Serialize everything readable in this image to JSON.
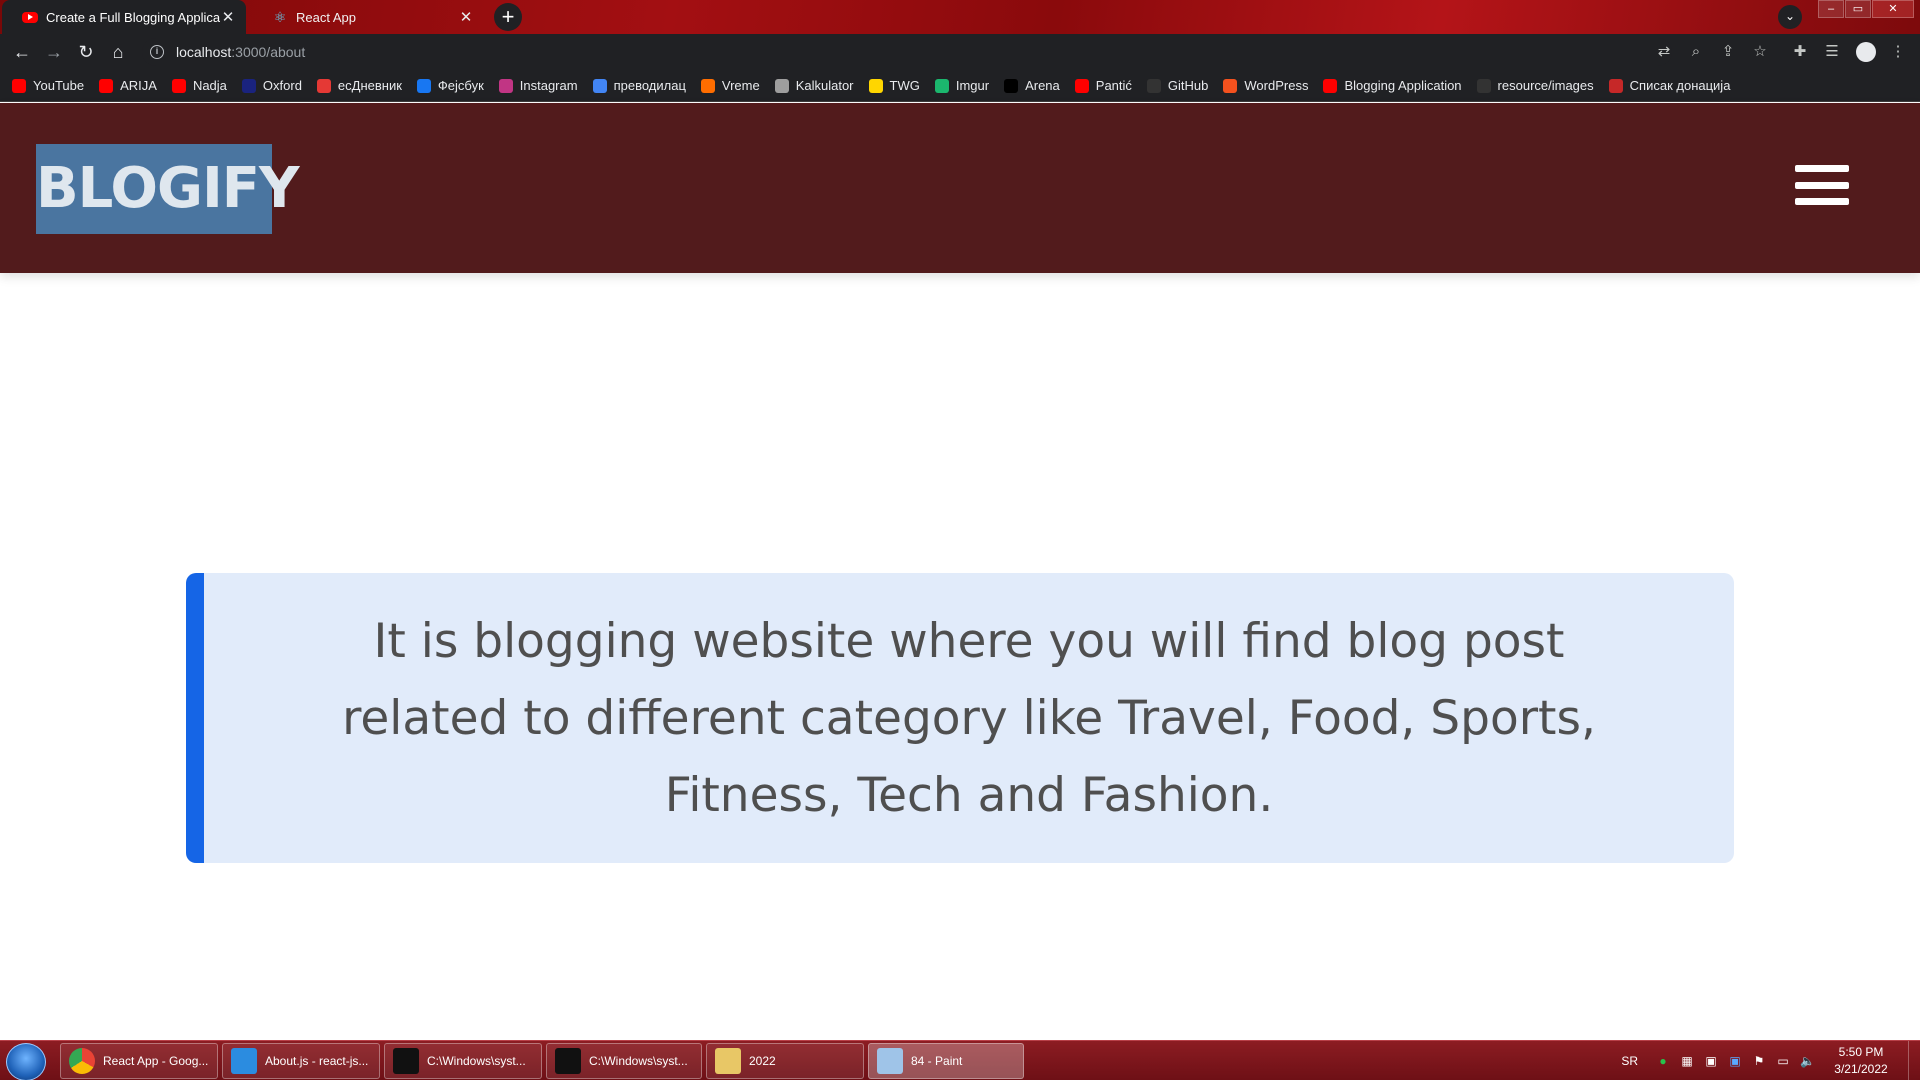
{
  "browser": {
    "tabs": [
      {
        "title": "Create a Full Blogging Applicatio",
        "favicon": "youtube-icon",
        "active": true
      },
      {
        "title": "React App",
        "favicon": "react-icon",
        "active": false
      }
    ],
    "url_host": "localhost",
    "url_path": ":3000/about",
    "bookmarks": [
      {
        "label": "YouTube",
        "icon": "youtube-icon",
        "color": "#ff0000"
      },
      {
        "label": "ARIJA",
        "icon": "youtube-icon",
        "color": "#ff0000"
      },
      {
        "label": "Nadja",
        "icon": "youtube-icon",
        "color": "#ff0000"
      },
      {
        "label": "Oxford",
        "icon": "oup-icon",
        "color": "#1a237e"
      },
      {
        "label": "есДневник",
        "icon": "e-diary-icon",
        "color": "#e53935"
      },
      {
        "label": "Фејсбук",
        "icon": "facebook-icon",
        "color": "#1877f2"
      },
      {
        "label": "Instagram",
        "icon": "instagram-icon",
        "color": "#c13584"
      },
      {
        "label": "преводилац",
        "icon": "translate-icon",
        "color": "#4285f4"
      },
      {
        "label": "Vreme",
        "icon": "weather-icon",
        "color": "#ff6d00"
      },
      {
        "label": "Kalkulator",
        "icon": "calculator-icon",
        "color": "#9e9e9e"
      },
      {
        "label": "TWG",
        "icon": "twg-icon",
        "color": "#ffd600"
      },
      {
        "label": "Imgur",
        "icon": "imgur-icon",
        "color": "#1bb76e"
      },
      {
        "label": "Arena",
        "icon": "arena-icon",
        "color": "#000000"
      },
      {
        "label": "Pantić",
        "icon": "youtube-icon",
        "color": "#ff0000"
      },
      {
        "label": "GitHub",
        "icon": "github-icon",
        "color": "#333333"
      },
      {
        "label": "WordPress",
        "icon": "wordpress-icon",
        "color": "#f4511e"
      },
      {
        "label": "Blogging Application",
        "icon": "youtube-icon",
        "color": "#ff0000"
      },
      {
        "label": "resource/images",
        "icon": "github-icon",
        "color": "#333333"
      },
      {
        "label": "Списак донација",
        "icon": "donation-icon",
        "color": "#c62828"
      }
    ]
  },
  "site": {
    "logo_text": "Blogify",
    "about_text": "It is blogging website where you will find blog post related to different category like Travel, Food, Sports, Fitness, Tech and Fashion."
  },
  "taskbar": {
    "tasks": [
      {
        "label": "React App - Goog...",
        "icon": "chrome-icon",
        "active": false
      },
      {
        "label": "About.js - react-js...",
        "icon": "vscode-icon",
        "active": false
      },
      {
        "label": "C:\\Windows\\syst...",
        "icon": "cmd-icon",
        "active": false
      },
      {
        "label": "C:\\Windows\\syst...",
        "icon": "cmd-icon",
        "active": false
      },
      {
        "label": "2022",
        "icon": "folder-icon",
        "active": false
      },
      {
        "label": "84 - Paint",
        "icon": "paint-icon",
        "active": true
      }
    ],
    "language": "SR",
    "time": "5:50 PM",
    "date": "3/21/2022"
  }
}
